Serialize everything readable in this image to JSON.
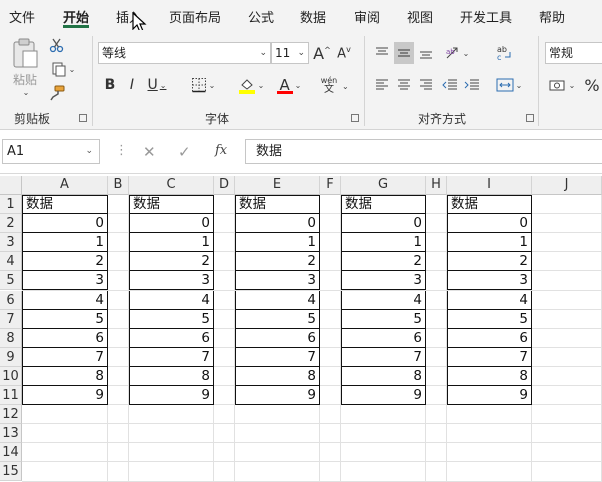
{
  "menu": {
    "items": [
      "文件",
      "开始",
      "插入",
      "页面布局",
      "公式",
      "数据",
      "审阅",
      "视图",
      "开发工具",
      "帮助"
    ],
    "active": "开始"
  },
  "ribbon": {
    "clipboard": {
      "label": "剪贴板",
      "paste_label": "粘贴"
    },
    "font": {
      "label": "字体",
      "font_name": "等线",
      "font_size": "11",
      "bold": "B",
      "italic": "I",
      "underline": "U",
      "font_color_glyph": "A",
      "phonetic_top": "wén",
      "phonetic_bottom": "文"
    },
    "alignment": {
      "label": "对齐方式"
    },
    "number": {
      "format": "常规",
      "percent": "%"
    },
    "colors": {
      "accent": "#217346",
      "highlight_yellow": "#ffff00",
      "font_red": "#ff0000"
    }
  },
  "formula_bar": {
    "name_box": "A1",
    "fx_label": "fx",
    "content": "数据"
  },
  "grid": {
    "columns": [
      "A",
      "B",
      "C",
      "D",
      "E",
      "F",
      "G",
      "H",
      "I",
      "J"
    ],
    "rows": [
      "1",
      "2",
      "3",
      "4",
      "5",
      "6",
      "7",
      "8",
      "9",
      "10",
      "11",
      "12",
      "13",
      "14",
      "15"
    ],
    "header_text": "数据",
    "values": [
      "0",
      "1",
      "2",
      "3",
      "4",
      "5",
      "6",
      "7",
      "8",
      "9"
    ],
    "data_columns": [
      "A",
      "C",
      "E",
      "G",
      "I"
    ]
  },
  "cursor": "pointer-arrow"
}
